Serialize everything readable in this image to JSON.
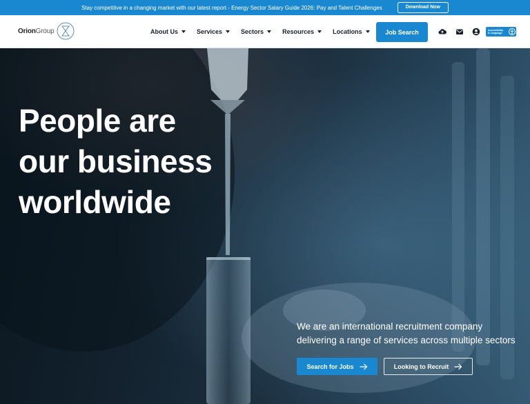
{
  "topbar": {
    "announcement": "Stay competitive in a changing market with our latest report - Energy Sector Salary Guide 2026: Pay and Talent Challenges",
    "download_label": "Download Now"
  },
  "header": {
    "logo": {
      "bold": "Orion",
      "light": "Group"
    },
    "nav": [
      {
        "label": "About Us"
      },
      {
        "label": "Services"
      },
      {
        "label": "Sectors"
      },
      {
        "label": "Resources"
      },
      {
        "label": "Locations"
      }
    ],
    "job_search_label": "Job Search",
    "icons": [
      "cloud-upload-icon",
      "mail-icon",
      "user-icon"
    ],
    "accessibility": {
      "line1": "Accessibility",
      "line2": "& Language"
    }
  },
  "hero": {
    "title": {
      "line1_bold": "People",
      "line1_rest": " are",
      "line2": "our business",
      "line3": "worldwide"
    },
    "description": "We are an international recruitment company delivering a range of services across multiple sectors",
    "primary_button": "Search for Jobs",
    "secondary_button": "Looking to Recruit"
  },
  "colors": {
    "accent": "#1a88d0",
    "header_bg": "#ffffff",
    "nav_text": "#16212b"
  }
}
